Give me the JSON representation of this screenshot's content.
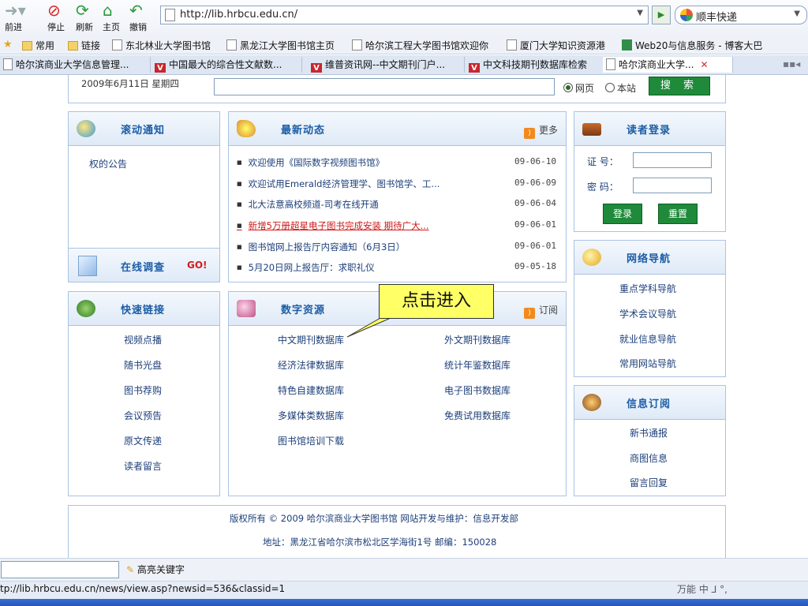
{
  "browser": {
    "nav": {
      "forward": "前进",
      "stop": "停止",
      "refresh": "刷新",
      "home": "主页",
      "undo": "撤销"
    },
    "url": "http://lib.hrbcu.edu.cn/",
    "search_engine": "顺丰快递",
    "favorites": [
      "常用",
      "链接",
      "东北林业大学图书馆",
      "黑龙江大学图书馆主页",
      "哈尔滨工程大学图书馆欢迎你",
      "厦门大学知识资源港",
      "Web20与信息服务 - 博客大巴"
    ],
    "tabs": [
      "哈尔滨商业大学信息管理...",
      "中国最大的综合性文献数...",
      "维普资讯网--中文期刊门户...",
      "中文科技期刊数据库检索",
      "哈尔滨商业大学..."
    ],
    "find_label": "高亮关键字",
    "status_url": "tp://lib.hrbcu.edu.cn/news/view.asp?newsid=536&classid=1",
    "ime_text": "万能 中 ⅃ °,"
  },
  "topbar": {
    "date": "2009年6月11日 星期四",
    "radio_web": "网页",
    "radio_site": "本站",
    "search_btn": "搜 索"
  },
  "scroll_notice": {
    "title": "滚动通知",
    "text": "权的公告"
  },
  "survey": {
    "title": "在线调查",
    "go": "GO!"
  },
  "news": {
    "title": "最新动态",
    "more": "更多",
    "items": [
      {
        "text": "欢迎使用《国际数字视频图书馆》",
        "date": "09-06-10"
      },
      {
        "text": "欢迎试用Emerald经济管理学、图书馆学、工...",
        "date": "09-06-09"
      },
      {
        "text": "北大法意高校频道-司考在线开通",
        "date": "09-06-04"
      },
      {
        "text": "新增5万册超星电子图书完成安装 期待广大...",
        "date": "09-06-01"
      },
      {
        "text": "图书馆网上报告厅内容通知（6月3日）",
        "date": "09-06-01"
      },
      {
        "text": "5月20日网上报告厅：求职礼仪",
        "date": "09-05-18"
      }
    ]
  },
  "login": {
    "title": "读者登录",
    "id_label": "证 号：",
    "pwd_label": "密 码：",
    "login_btn": "登录",
    "reset_btn": "重置"
  },
  "quicklinks": {
    "title": "快速链接",
    "items": [
      "视频点播",
      "随书光盘",
      "图书荐购",
      "会议预告",
      "原文传递",
      "读者留言"
    ]
  },
  "digital": {
    "title": "数字资源",
    "subscribe": "订阅",
    "left": [
      "中文期刊数据库",
      "经济法律数据库",
      "特色自建数据库",
      "多媒体类数据库",
      "图书馆培训下载"
    ],
    "right": [
      "外文期刊数据库",
      "统计年鉴数据库",
      "电子图书数据库",
      "免费试用数据库"
    ]
  },
  "callout": "点击进入",
  "netnav": {
    "title": "网络导航",
    "items": [
      "重点学科导航",
      "学术会议导航",
      "就业信息导航",
      "常用网站导航"
    ]
  },
  "subscription": {
    "title": "信息订阅",
    "items": [
      "新书通报",
      "商图信息",
      "留言回复"
    ]
  },
  "footer": {
    "copyright": "版权所有 © 2009 哈尔滨商业大学图书馆 网站开发与维护：信息开发部",
    "address": "地址：黑龙江省哈尔滨市松北区学海街1号 邮编：150028"
  }
}
